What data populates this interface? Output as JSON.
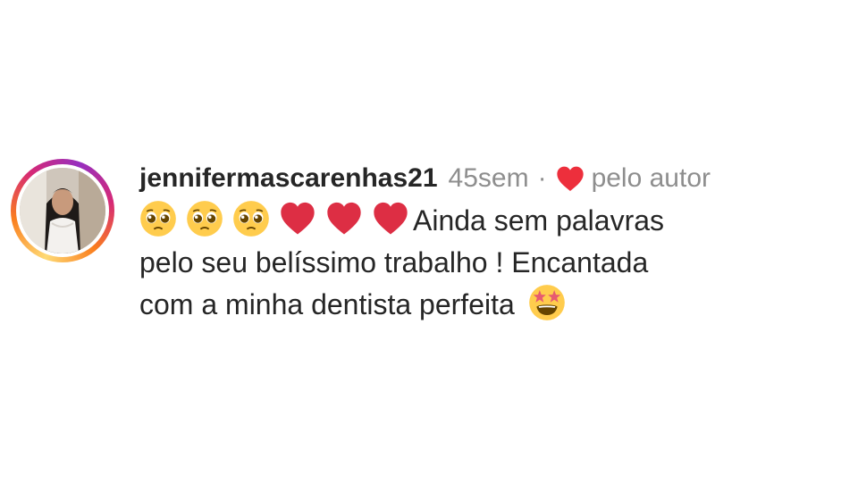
{
  "comment": {
    "username": "jennifermascarenhas21",
    "time_ago": "45sem",
    "separator": "·",
    "liked_by_author_label": "pelo autor",
    "text_line1": "Ainda sem palavras",
    "text_line2": "pelo seu belíssimo trabalho ! Encantada",
    "text_line3": "com a minha dentista perfeita",
    "leading_emojis": [
      "pleading-face",
      "pleading-face",
      "pleading-face",
      "red-heart",
      "red-heart",
      "red-heart"
    ],
    "trailing_emoji": "star-struck"
  },
  "colors": {
    "heart": "#ed2f3c",
    "username": "#262626",
    "secondary": "#8e8e8e"
  }
}
